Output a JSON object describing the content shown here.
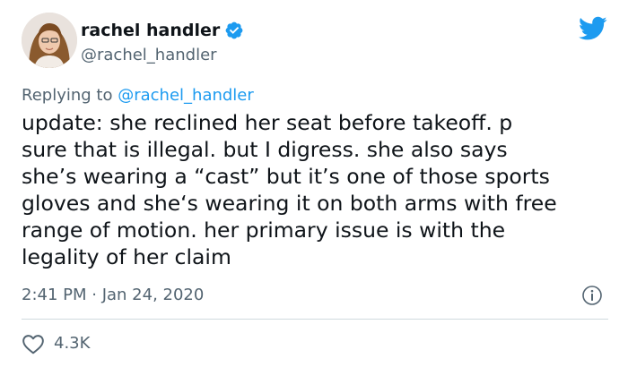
{
  "author": {
    "display_name": "rachel handler",
    "handle": "@rachel_handler",
    "verified": true
  },
  "reply": {
    "prefix": "Replying to",
    "mention": "@rachel_handler"
  },
  "tweet": {
    "text": "update: she reclined her seat before takeoff. p\nsure that is illegal. but I digress. she also says\nshe’s wearing a “cast” but it’s one of those sports\ngloves and she‘s wearing it on both arms with free\nrange of motion. her primary issue is with the\nlegality of her claim"
  },
  "meta": {
    "timestamp": "2:41 PM · Jan 24, 2020"
  },
  "engagement": {
    "likes": "4.3K"
  },
  "icons": {
    "brand": "twitter-bird-icon",
    "verified": "verified-badge-icon",
    "info": "info-icon",
    "like": "heart-icon"
  },
  "colors": {
    "brand_blue": "#1d9bf0",
    "text_primary": "#0f1419",
    "text_secondary": "#536471",
    "divider": "#cfd9de"
  }
}
